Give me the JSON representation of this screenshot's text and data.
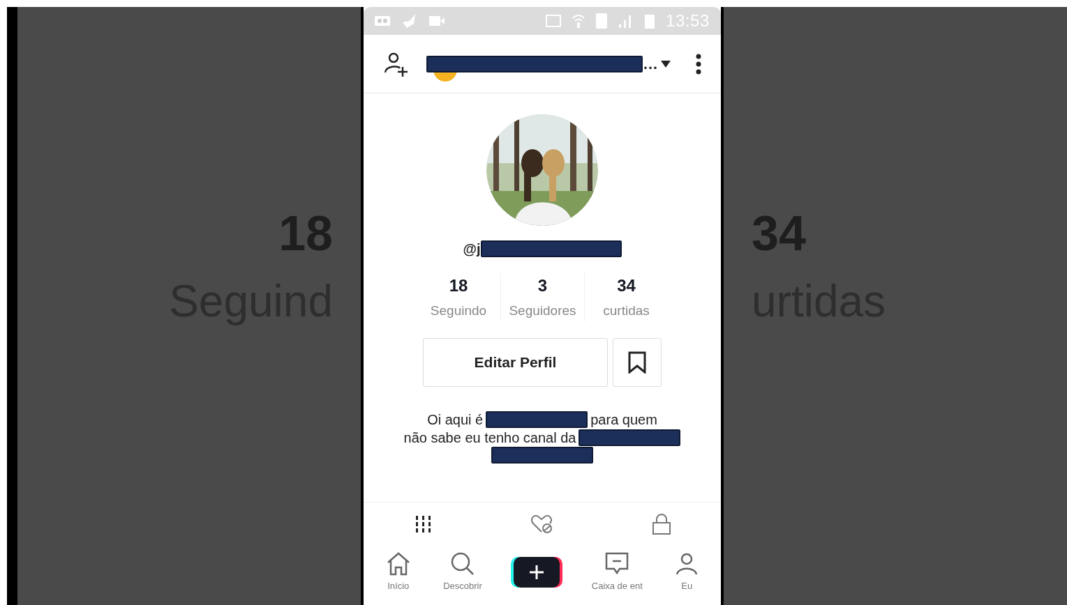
{
  "backdrop": {
    "left": {
      "count": "18",
      "label": "Seguind"
    },
    "right": {
      "count": "34",
      "label": "urtidas"
    }
  },
  "status_bar": {
    "time": "13:53"
  },
  "header": {
    "title_tail": "…",
    "title_redacted": true
  },
  "profile": {
    "handle": "@j",
    "handle_redacted": true
  },
  "stats": [
    {
      "count": "18",
      "label": "Seguindo"
    },
    {
      "count": "3",
      "label": "Seguidores"
    },
    {
      "count": "34",
      "label": "curtidas"
    }
  ],
  "edit_button": "Editar Perfil",
  "bio": [
    {
      "before": "Oi aqui é",
      "redacted": true,
      "after": "para quem"
    },
    {
      "before": "não sabe eu tenho canal da",
      "redacted": true
    },
    {
      "redacted": true
    }
  ],
  "content_tabs": [
    {
      "kind": "grid",
      "selected": true
    },
    {
      "kind": "liked",
      "selected": false
    },
    {
      "kind": "private",
      "selected": false
    }
  ],
  "nav": [
    {
      "kind": "home",
      "label": "Início"
    },
    {
      "kind": "search",
      "label": "Descobrir"
    },
    {
      "kind": "create"
    },
    {
      "kind": "inbox",
      "label": "Caixa de ent"
    },
    {
      "kind": "profile",
      "label": "Eu"
    }
  ]
}
